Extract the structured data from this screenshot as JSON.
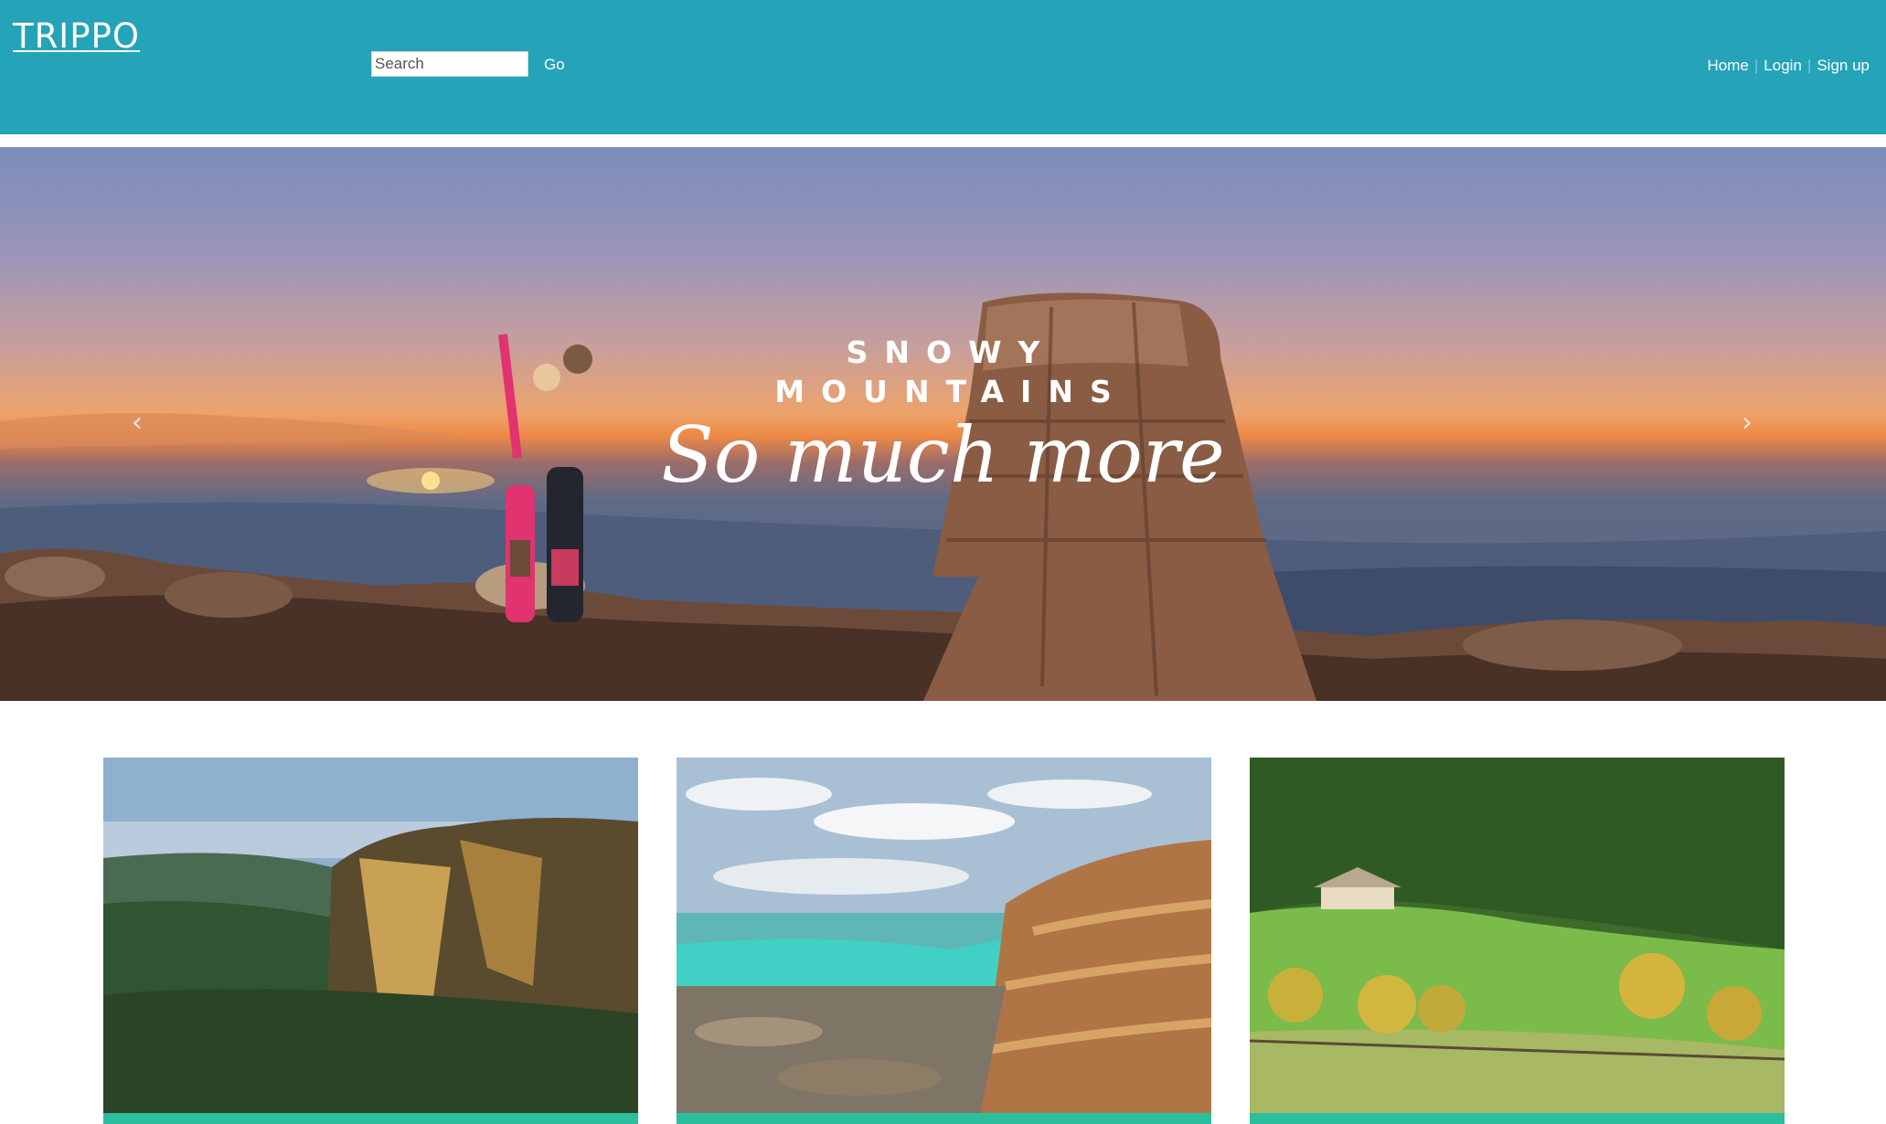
{
  "header": {
    "logo": "TRIPPO",
    "search": {
      "placeholder": "Search",
      "value": ""
    },
    "go_label": "Go",
    "nav": [
      {
        "label": "Home"
      },
      {
        "label": "Login"
      },
      {
        "label": "Sign up"
      }
    ],
    "separator": "|",
    "background_color": "#24a3b9"
  },
  "hero": {
    "line1": "SNOWY",
    "line2": "MOUNTAINS",
    "script": "So much more",
    "prev_icon": "‹",
    "next_icon": "›"
  },
  "cards": [
    {
      "image": "blue-mountains-cliffs"
    },
    {
      "image": "coastal-rock-platform"
    },
    {
      "image": "farmhouse-green-valley"
    }
  ],
  "colors": {
    "accent": "#2bbf9d",
    "header": "#24a3b9"
  }
}
